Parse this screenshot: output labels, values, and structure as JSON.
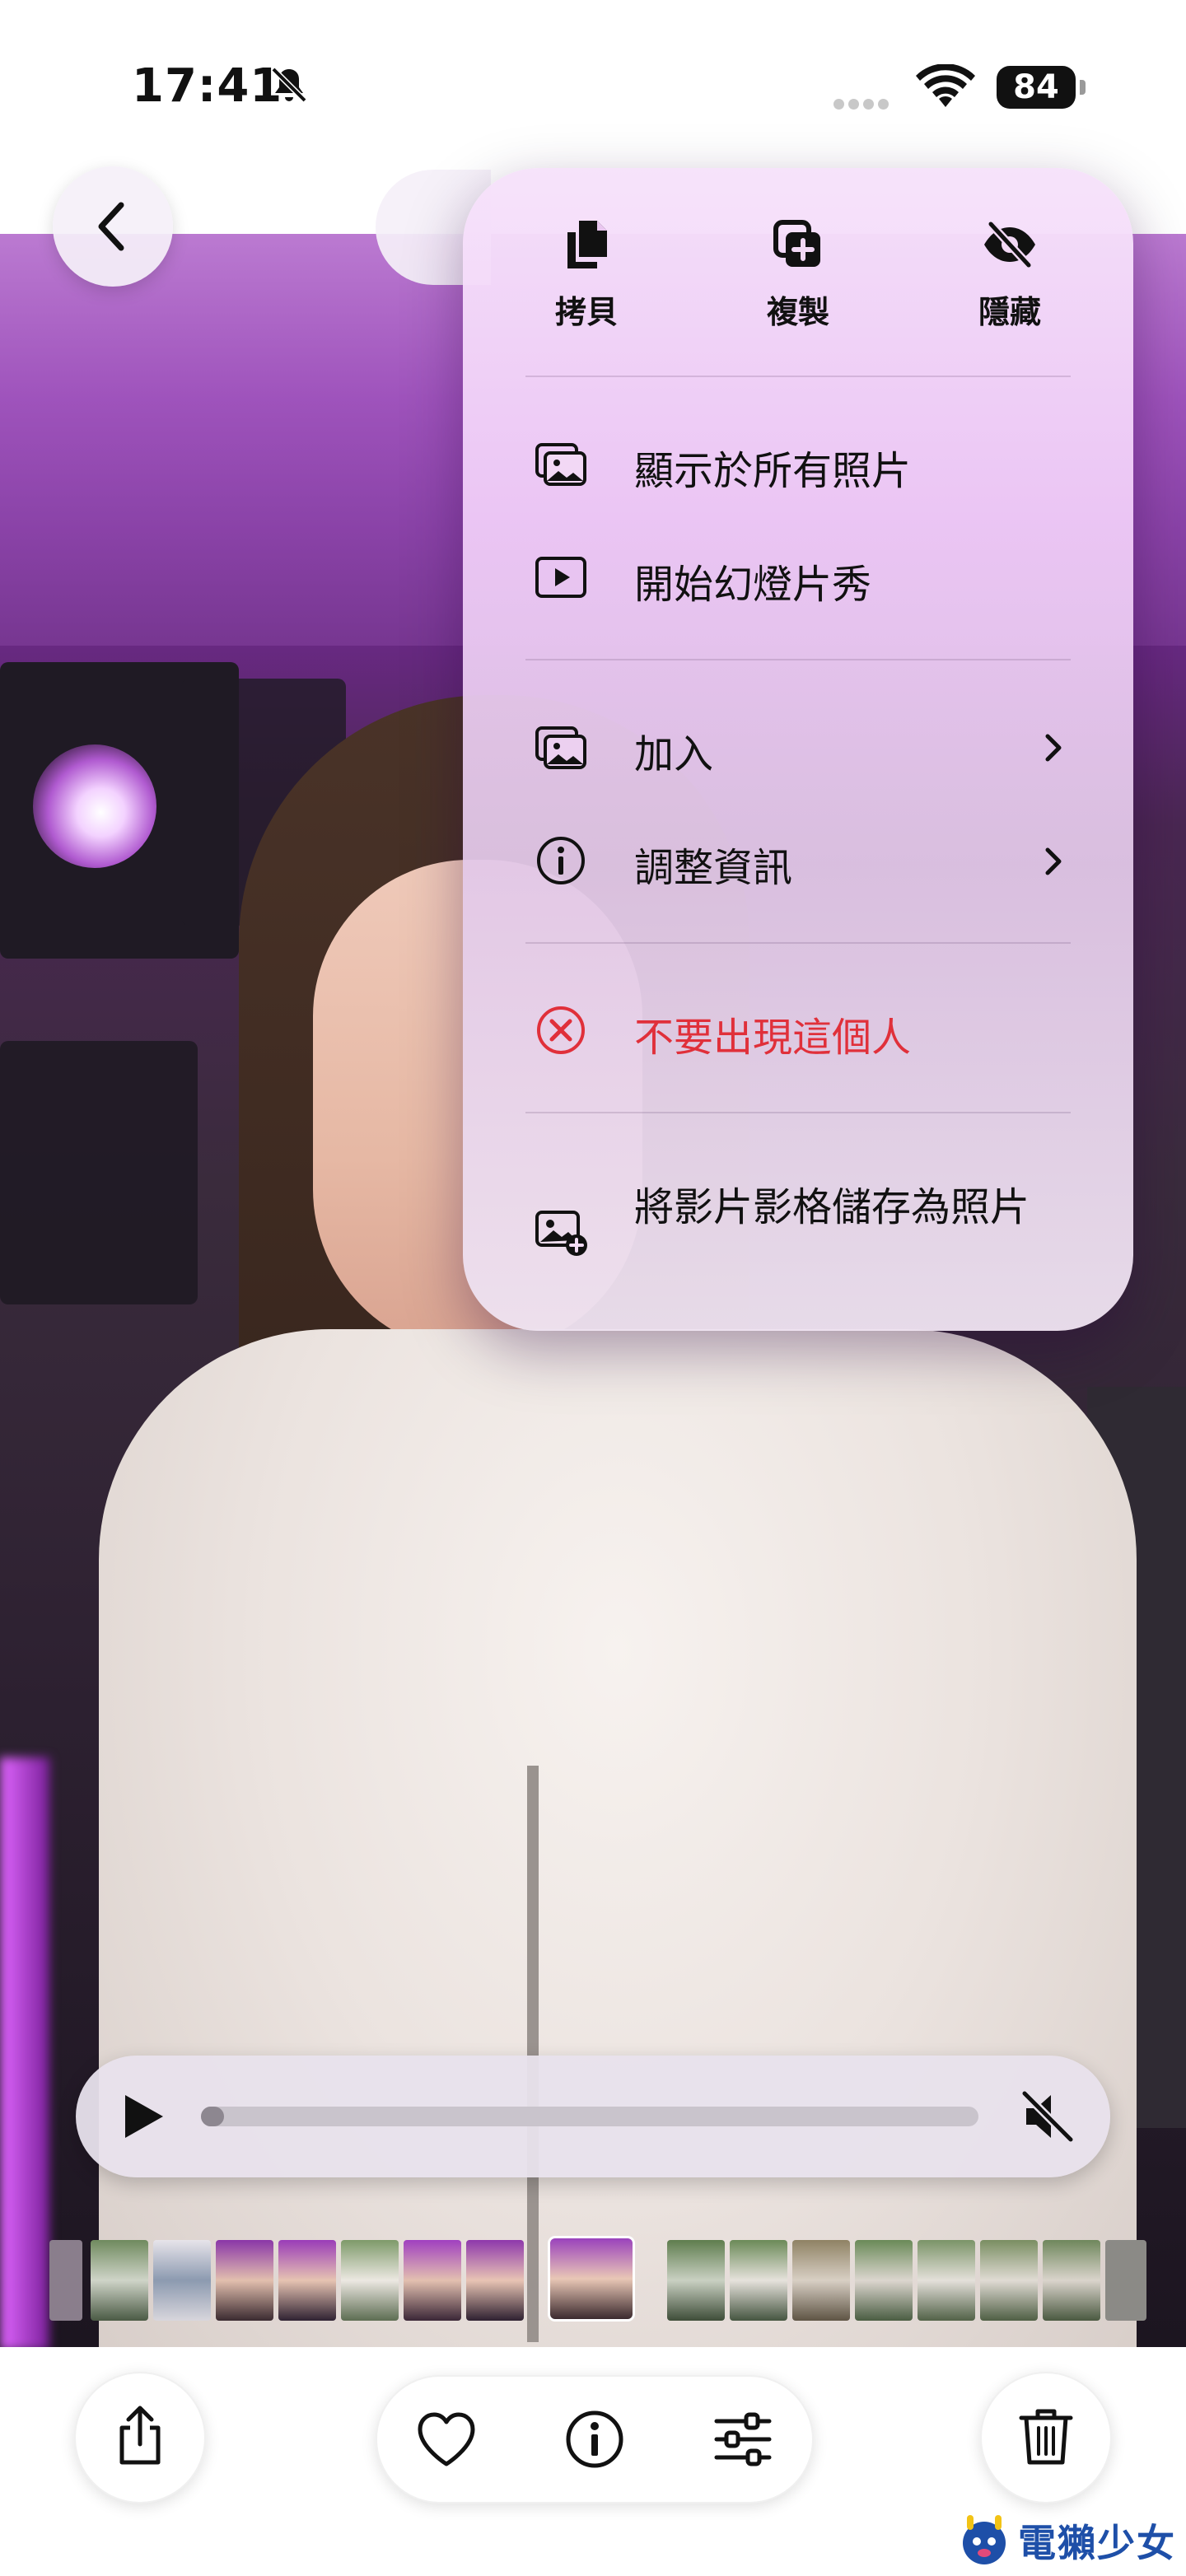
{
  "status_bar": {
    "time": "17:41",
    "battery": "84"
  },
  "menu": {
    "quick_actions": [
      {
        "label": "拷貝",
        "icon": "copy-icon"
      },
      {
        "label": "複製",
        "icon": "duplicate-icon"
      },
      {
        "label": "隱藏",
        "icon": "hide-eye-icon"
      }
    ],
    "items": [
      {
        "label": "顯示於所有照片",
        "icon": "photos-stack-icon"
      },
      {
        "label": "開始幻燈片秀",
        "icon": "slideshow-play-icon"
      },
      {
        "label": "加入",
        "icon": "photos-stack-icon",
        "has_submenu": true
      },
      {
        "label": "調整資訊",
        "icon": "info-icon",
        "has_submenu": true
      },
      {
        "label": "不要出現這個人",
        "icon": "remove-circle-icon",
        "destructive": true,
        "color": "#e0303a"
      },
      {
        "label": "將影片影格儲存為照片",
        "icon": "save-frame-photo-icon"
      }
    ]
  },
  "video": {
    "progress": 0.03,
    "playing": false,
    "muted": true
  },
  "toolbar": {
    "left": "share-icon",
    "center": [
      "heart-icon",
      "info-icon",
      "adjust-sliders-icon"
    ],
    "right": "trash-icon"
  },
  "watermark": {
    "text": "電獺少女"
  },
  "colors": {
    "accent_destructive": "#e0303a",
    "menu_bg": "#f0ccf8"
  }
}
